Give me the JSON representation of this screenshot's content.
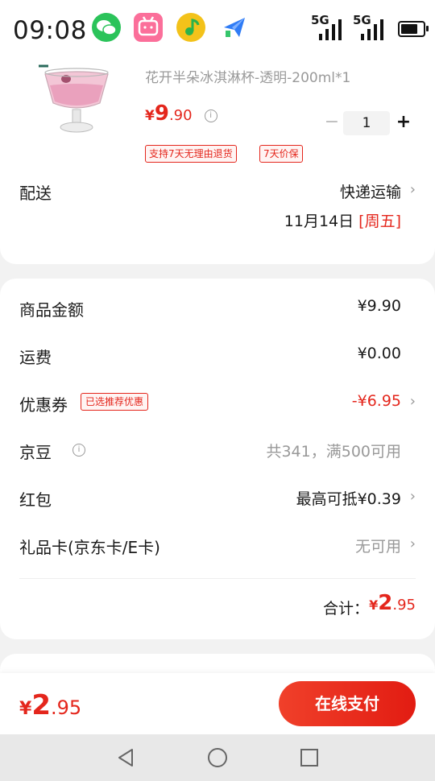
{
  "status_bar": {
    "time": "09:08",
    "sim1": "5G",
    "sim2": "5G"
  },
  "product": {
    "title": "花开半朵冰淇淋杯-透明-200ml*1",
    "price_currency": "¥",
    "price_int": "9",
    "price_dec": ".90",
    "quantity": "1",
    "minus_label": "−",
    "plus_label": "+",
    "tags": [
      "支持7天无理由退货",
      "7天价保"
    ]
  },
  "delivery": {
    "label": "配送",
    "method": "快递运输",
    "date": "11月14日 ",
    "weekday": "[周五]"
  },
  "summary": {
    "goods_amount_label": "商品金额",
    "goods_amount": "¥9.90",
    "shipping_label": "运费",
    "shipping": "¥0.00",
    "coupon_label": "优惠券",
    "coupon_tag": "已选推荐优惠",
    "coupon_value": "-¥6.95",
    "jingdou_label": "京豆",
    "jingdou_value": "共341，满500可用",
    "redpacket_label": "红包",
    "redpacket_value": "最高可抵¥0.39",
    "giftcard_label": "礼品卡(京东卡/E卡)",
    "giftcard_value": "无可用",
    "total_label": "合计：",
    "total_currency": "¥",
    "total_int": "2",
    "total_dec": ".95"
  },
  "paybar": {
    "currency": "¥",
    "total_int": "2",
    "total_dec": ".95",
    "pay_button": "在线支付"
  },
  "icons": {
    "info": "i",
    "chevron": "›"
  },
  "colors": {
    "accent": "#e4261c"
  }
}
